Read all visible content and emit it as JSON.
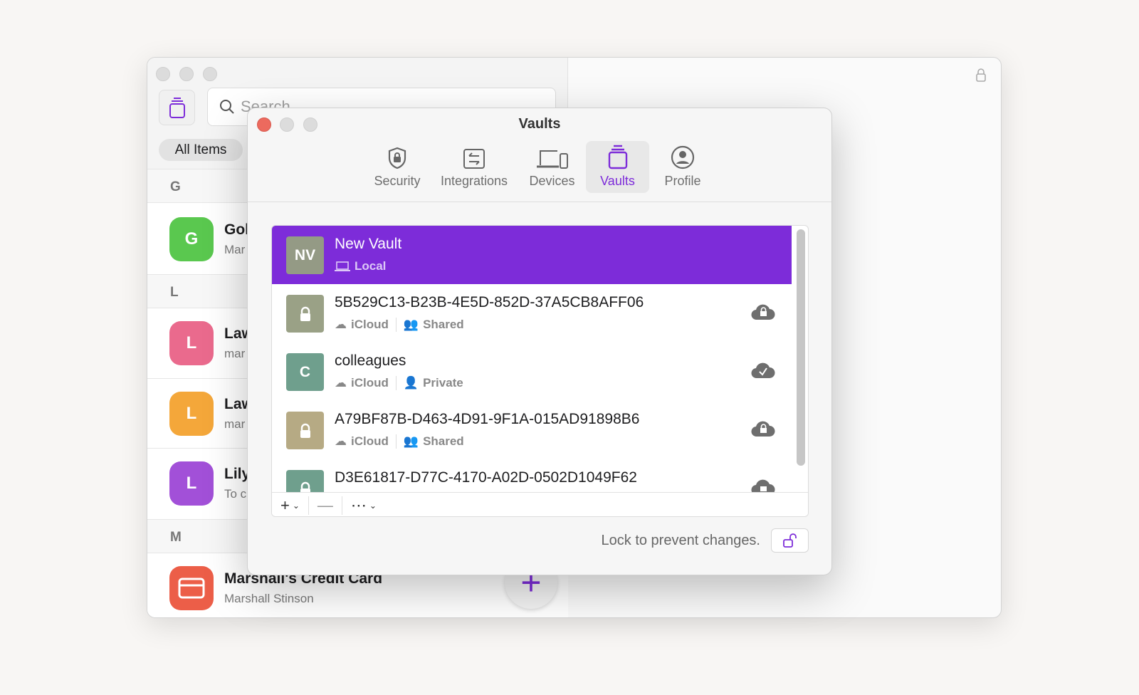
{
  "main_window": {
    "search_placeholder": "Search",
    "filter_pill": "All Items",
    "sections": [
      {
        "letter": "G",
        "items": [
          {
            "initial": "G",
            "title": "Gol",
            "subtitle": "Mar",
            "color": "#5ac84f"
          }
        ]
      },
      {
        "letter": "L",
        "items": [
          {
            "initial": "L",
            "title": "Law",
            "subtitle": "mar",
            "color": "#ea6a8d"
          },
          {
            "initial": "L",
            "title": "Law",
            "subtitle": "mar",
            "color": "#f4a73a"
          },
          {
            "initial": "L",
            "title": "Lily",
            "subtitle": "To c",
            "color": "#a250d8"
          }
        ]
      },
      {
        "letter": "M",
        "items": [
          {
            "title": "Marshall's Credit Card",
            "subtitle": "Marshall Stinson",
            "color": "#ec5e48",
            "icon": "credit-card-icon"
          }
        ]
      }
    ]
  },
  "dialog": {
    "title": "Vaults",
    "tabs": [
      {
        "label": "Security",
        "icon": "shield-lock-icon"
      },
      {
        "label": "Integrations",
        "icon": "arrows-exchange-icon"
      },
      {
        "label": "Devices",
        "icon": "devices-icon"
      },
      {
        "label": "Vaults",
        "icon": "vault-icon",
        "active": true
      },
      {
        "label": "Profile",
        "icon": "person-circle-icon"
      }
    ],
    "vaults": [
      {
        "initials": "NV",
        "name": "New Vault",
        "location": "Local",
        "color": "#949a85",
        "selected": true
      },
      {
        "name": "5B529C13-B23B-4E5D-852D-37A5CB8AFF06",
        "location": "iCloud",
        "sharing": "Shared",
        "color": "#9aa186",
        "status": "cloud-lock-icon"
      },
      {
        "initials": "C",
        "name": "colleagues",
        "location": "iCloud",
        "sharing": "Private",
        "color": "#6f9f8d",
        "status": "cloud-check-icon"
      },
      {
        "name": "A79BF87B-D463-4D91-9F1A-015AD91898B6",
        "location": "iCloud",
        "sharing": "Shared",
        "color": "#b6aa84",
        "status": "cloud-lock-icon"
      },
      {
        "name": "D3E61817-D77C-4170-A02D-0502D1049F62",
        "color": "#6f9f8d",
        "status": "cloud-lock-icon"
      }
    ],
    "footer_text": "Lock to prevent changes.",
    "accent": "#7d2cd9"
  }
}
